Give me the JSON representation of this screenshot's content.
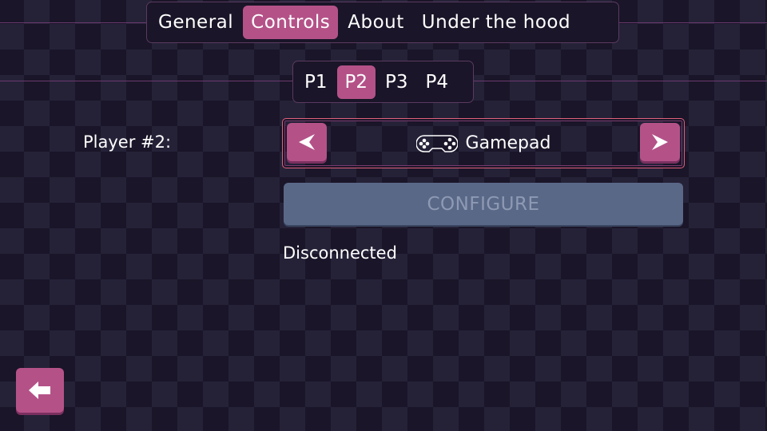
{
  "tabs": [
    {
      "label": "General"
    },
    {
      "label": "Controls",
      "active": true
    },
    {
      "label": "About"
    },
    {
      "label": "Under the hood"
    }
  ],
  "player_tabs": [
    {
      "label": "P1"
    },
    {
      "label": "P2",
      "active": true
    },
    {
      "label": "P3"
    },
    {
      "label": "P4"
    }
  ],
  "player_label": "Player #2:",
  "device": {
    "value": "Gamepad",
    "icon": "gamepad-icon",
    "prev_icon": "arrow-left-icon",
    "next_icon": "arrow-right-icon"
  },
  "configure_label": "CONFIGURE",
  "status": "Disconnected",
  "back_icon": "back-arrow-icon",
  "colors": {
    "accent": "#b45288",
    "disabled": "#5a6888",
    "border": "#e0607a"
  }
}
